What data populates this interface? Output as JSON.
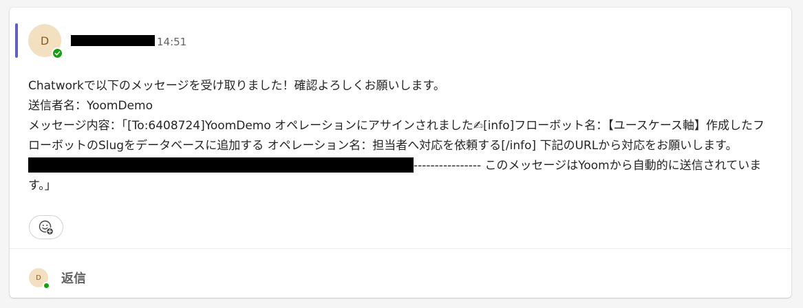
{
  "message": {
    "avatar_initial": "D",
    "timestamp": "14:51",
    "lines": {
      "l1": "Chatworkで以下のメッセージを受け取りました！確認よろしくお願いします。",
      "l2": "送信者名：YoomDemo",
      "l3_part1": "メッセージ内容：「[To:6408724]YoomDemo オペレーションにアサインされました",
      "l3_emoji": "✍",
      "l3_part2": "[info]フローボット名：【ユースケース軸】作成したフローボットのSlugをデータベースに追加する オペレーション名：担当者へ対応を依頼する[/info] 下記のURLから対応をお願いします。",
      "l4_tail": "---------------- このメッセージはYoomから自動的に送信されています。」"
    }
  },
  "reply": {
    "avatar_initial": "D",
    "label": "返信"
  },
  "colors": {
    "accent": "#5b5fc7",
    "presence": "#13a10e",
    "avatar_bg": "#f3e0c1"
  },
  "icons": {
    "reaction": "add-reaction-icon",
    "presence": "checkmark-icon"
  }
}
